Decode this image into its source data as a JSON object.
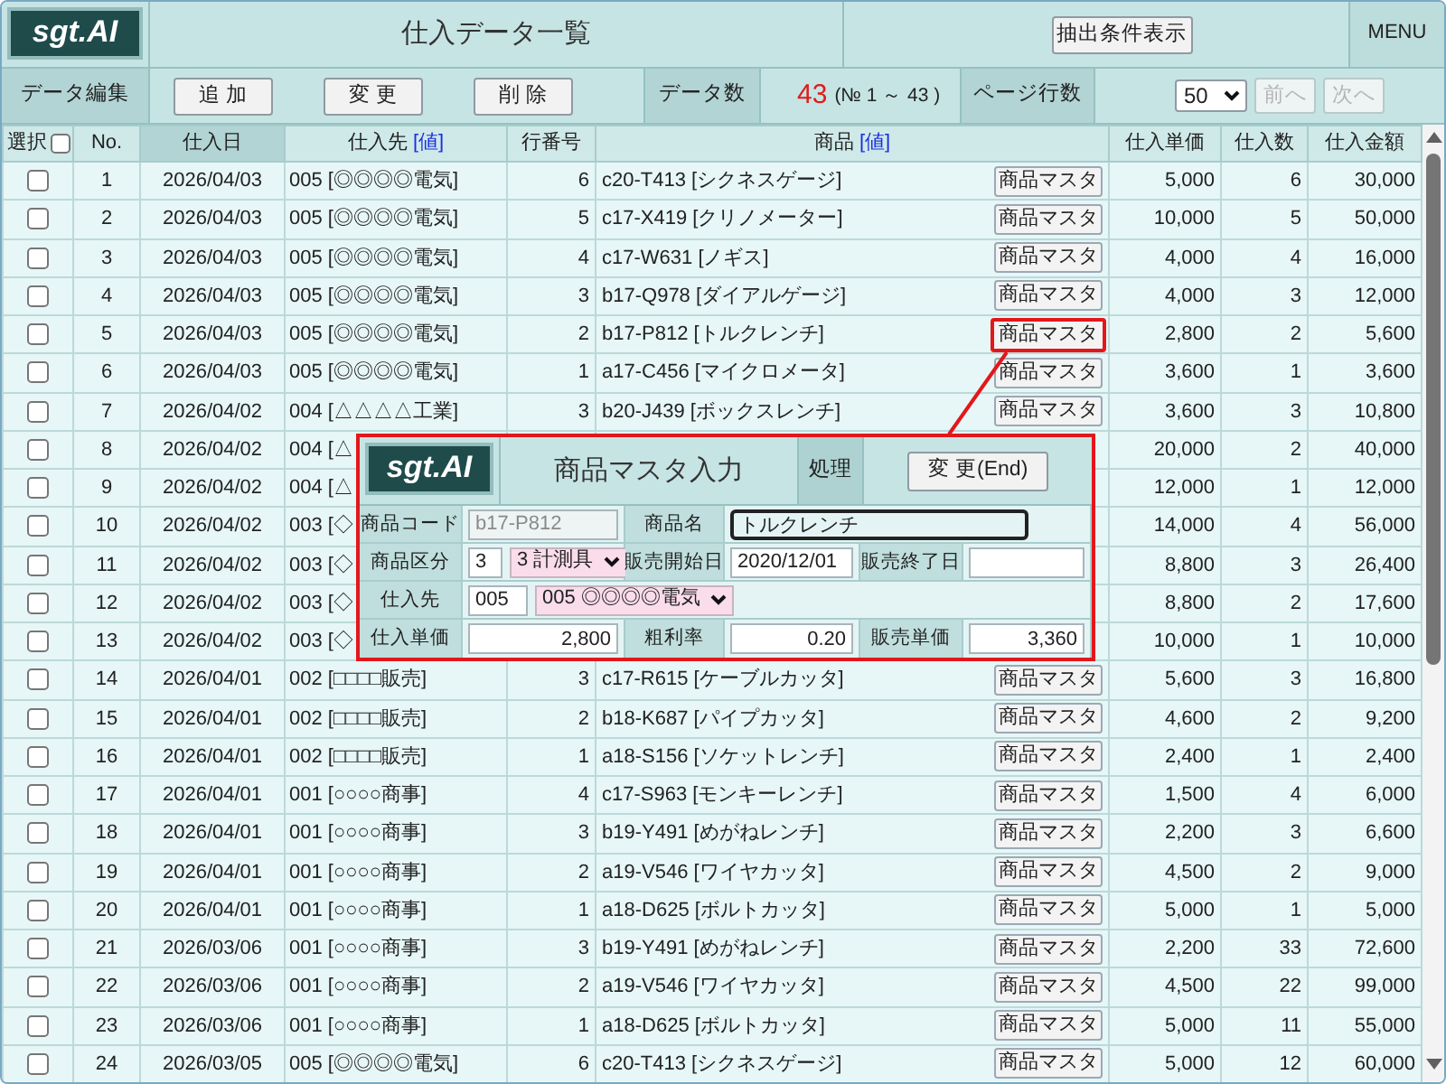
{
  "app": {
    "logo": "sgt.AI",
    "title": "仕入データ一覧",
    "filter_button": "抽出条件表示",
    "menu": "MENU"
  },
  "toolbar": {
    "edit_label": "データ編集",
    "edit_buttons": [
      "追 加",
      "変 更",
      "削 除"
    ],
    "count_label": "データ数",
    "count": "43",
    "range": "(№ 1 ～ 43 )",
    "page_rows_label": "ページ行数",
    "page_rows": "50",
    "nav_buttons": [
      {
        "label": "前へ",
        "disabled": true
      },
      {
        "label": "次へ",
        "disabled": true
      }
    ]
  },
  "table": {
    "columns": [
      {
        "label": "選択",
        "kind": "checkbox",
        "checked": false,
        "sorted": false
      },
      {
        "label": "No.",
        "kind": "text",
        "sorted": false
      },
      {
        "label": "仕入日",
        "kind": "text",
        "sorted": true
      },
      {
        "label": "仕入先",
        "kind": "link",
        "link": "[値]",
        "sorted": false
      },
      {
        "label": "行番号",
        "kind": "text",
        "sorted": false
      },
      {
        "label": "商品",
        "kind": "link",
        "link": "[値]",
        "sorted": false
      },
      {
        "label": "仕入単価",
        "kind": "text",
        "sorted": false
      },
      {
        "label": "仕入数",
        "kind": "text",
        "sorted": false
      },
      {
        "label": "仕入金額",
        "kind": "text",
        "sorted": false
      }
    ],
    "rows": [
      {
        "checked": false,
        "no": "1",
        "date": "2026/04/03",
        "supplier": "005 [◎◎◎◎電気]",
        "line": "6",
        "product": "c20-T413 [シクネスゲージ]",
        "master_button": "商品マスタ",
        "highlighted": false,
        "unit_price": "5,000",
        "qty": "6",
        "amount": "30,000"
      },
      {
        "checked": false,
        "no": "2",
        "date": "2026/04/03",
        "supplier": "005 [◎◎◎◎電気]",
        "line": "5",
        "product": "c17-X419 [クリノメーター]",
        "master_button": "商品マスタ",
        "highlighted": false,
        "unit_price": "10,000",
        "qty": "5",
        "amount": "50,000"
      },
      {
        "checked": false,
        "no": "3",
        "date": "2026/04/03",
        "supplier": "005 [◎◎◎◎電気]",
        "line": "4",
        "product": "c17-W631 [ノギス]",
        "master_button": "商品マスタ",
        "highlighted": false,
        "unit_price": "4,000",
        "qty": "4",
        "amount": "16,000"
      },
      {
        "checked": false,
        "no": "4",
        "date": "2026/04/03",
        "supplier": "005 [◎◎◎◎電気]",
        "line": "3",
        "product": "b17-Q978 [ダイアルゲージ]",
        "master_button": "商品マスタ",
        "highlighted": false,
        "unit_price": "4,000",
        "qty": "3",
        "amount": "12,000"
      },
      {
        "checked": false,
        "no": "5",
        "date": "2026/04/03",
        "supplier": "005 [◎◎◎◎電気]",
        "line": "2",
        "product": "b17-P812 [トルクレンチ]",
        "master_button": "商品マスタ",
        "highlighted": true,
        "unit_price": "2,800",
        "qty": "2",
        "amount": "5,600"
      },
      {
        "checked": false,
        "no": "6",
        "date": "2026/04/03",
        "supplier": "005 [◎◎◎◎電気]",
        "line": "1",
        "product": "a17-C456 [マイクロメータ]",
        "master_button": "商品マスタ",
        "highlighted": false,
        "unit_price": "3,600",
        "qty": "1",
        "amount": "3,600"
      },
      {
        "checked": false,
        "no": "7",
        "date": "2026/04/02",
        "supplier": "004 [△△△△工業]",
        "line": "3",
        "product": "b20-J439 [ボックスレンチ]",
        "master_button": "商品マスタ",
        "highlighted": false,
        "unit_price": "3,600",
        "qty": "3",
        "amount": "10,800"
      },
      {
        "checked": false,
        "no": "8",
        "date": "2026/04/02",
        "supplier": "004 [△",
        "unit_price": "20,000",
        "qty": "2",
        "amount": "40,000"
      },
      {
        "checked": false,
        "no": "9",
        "date": "2026/04/02",
        "supplier": "004 [△",
        "unit_price": "12,000",
        "qty": "1",
        "amount": "12,000"
      },
      {
        "checked": false,
        "no": "10",
        "date": "2026/04/02",
        "supplier": "003 [◇",
        "unit_price": "14,000",
        "qty": "4",
        "amount": "56,000"
      },
      {
        "checked": false,
        "no": "11",
        "date": "2026/04/02",
        "supplier": "003 [◇",
        "unit_price": "8,800",
        "qty": "3",
        "amount": "26,400"
      },
      {
        "checked": false,
        "no": "12",
        "date": "2026/04/02",
        "supplier": "003 [◇",
        "unit_price": "8,800",
        "qty": "2",
        "amount": "17,600"
      },
      {
        "checked": false,
        "no": "13",
        "date": "2026/04/02",
        "supplier": "003 [◇",
        "unit_price": "10,000",
        "qty": "1",
        "amount": "10,000"
      },
      {
        "checked": false,
        "no": "14",
        "date": "2026/04/01",
        "supplier": "002 [□□□□販売]",
        "line": "3",
        "product": "c17-R615 [ケーブルカッタ]",
        "master_button": "商品マスタ",
        "highlighted": false,
        "unit_price": "5,600",
        "qty": "3",
        "amount": "16,800"
      },
      {
        "checked": false,
        "no": "15",
        "date": "2026/04/01",
        "supplier": "002 [□□□□販売]",
        "line": "2",
        "product": "b18-K687 [パイプカッタ]",
        "master_button": "商品マスタ",
        "highlighted": false,
        "unit_price": "4,600",
        "qty": "2",
        "amount": "9,200"
      },
      {
        "checked": false,
        "no": "16",
        "date": "2026/04/01",
        "supplier": "002 [□□□□販売]",
        "line": "1",
        "product": "a18-S156 [ソケットレンチ]",
        "master_button": "商品マスタ",
        "highlighted": false,
        "unit_price": "2,400",
        "qty": "1",
        "amount": "2,400"
      },
      {
        "checked": false,
        "no": "17",
        "date": "2026/04/01",
        "supplier": "001 [○○○○商事]",
        "line": "4",
        "product": "c17-S963 [モンキーレンチ]",
        "master_button": "商品マスタ",
        "highlighted": false,
        "unit_price": "1,500",
        "qty": "4",
        "amount": "6,000"
      },
      {
        "checked": false,
        "no": "18",
        "date": "2026/04/01",
        "supplier": "001 [○○○○商事]",
        "line": "3",
        "product": "b19-Y491 [めがねレンチ]",
        "master_button": "商品マスタ",
        "highlighted": false,
        "unit_price": "2,200",
        "qty": "3",
        "amount": "6,600"
      },
      {
        "checked": false,
        "no": "19",
        "date": "2026/04/01",
        "supplier": "001 [○○○○商事]",
        "line": "2",
        "product": "a19-V546 [ワイヤカッタ]",
        "master_button": "商品マスタ",
        "highlighted": false,
        "unit_price": "4,500",
        "qty": "2",
        "amount": "9,000"
      },
      {
        "checked": false,
        "no": "20",
        "date": "2026/04/01",
        "supplier": "001 [○○○○商事]",
        "line": "1",
        "product": "a18-D625 [ボルトカッタ]",
        "master_button": "商品マスタ",
        "highlighted": false,
        "unit_price": "5,000",
        "qty": "1",
        "amount": "5,000"
      },
      {
        "checked": false,
        "no": "21",
        "date": "2026/03/06",
        "supplier": "001 [○○○○商事]",
        "line": "3",
        "product": "b19-Y491 [めがねレンチ]",
        "master_button": "商品マスタ",
        "highlighted": false,
        "unit_price": "2,200",
        "qty": "33",
        "amount": "72,600"
      },
      {
        "checked": false,
        "no": "22",
        "date": "2026/03/06",
        "supplier": "001 [○○○○商事]",
        "line": "2",
        "product": "a19-V546 [ワイヤカッタ]",
        "master_button": "商品マスタ",
        "highlighted": false,
        "unit_price": "4,500",
        "qty": "22",
        "amount": "99,000"
      },
      {
        "checked": false,
        "no": "23",
        "date": "2026/03/06",
        "supplier": "001 [○○○○商事]",
        "line": "1",
        "product": "a18-D625 [ボルトカッタ]",
        "master_button": "商品マスタ",
        "highlighted": false,
        "unit_price": "5,000",
        "qty": "11",
        "amount": "55,000"
      },
      {
        "checked": false,
        "no": "24",
        "date": "2026/03/05",
        "supplier": "005 [◎◎◎◎電気]",
        "line": "6",
        "product": "c20-T413 [シクネスゲージ]",
        "master_button": "商品マスタ",
        "highlighted": false,
        "unit_price": "5,000",
        "qty": "12",
        "amount": "60,000"
      }
    ]
  },
  "popup": {
    "logo": "sgt.AI",
    "title": "商品マスタ入力",
    "action_label": "処理",
    "action_button": "変 更(End)",
    "rows": [
      [
        {
          "kind": "label",
          "text": "商品コード"
        },
        {
          "kind": "fields",
          "controls": [
            {
              "kind": "text",
              "value": "b17-P812",
              "disabled": true,
              "focused": false
            }
          ]
        },
        {
          "kind": "label",
          "text": "商品名"
        },
        {
          "kind": "fields",
          "controls": [
            {
              "kind": "text",
              "value": "トルクレンチ",
              "disabled": false,
              "focused": true
            }
          ]
        }
      ],
      [
        {
          "kind": "label",
          "text": "商品区分"
        },
        {
          "kind": "fields",
          "controls": [
            {
              "kind": "text",
              "value": "3",
              "disabled": false,
              "focused": false
            },
            {
              "kind": "select",
              "value": "3 計測具"
            }
          ]
        },
        {
          "kind": "label",
          "text": "販売開始日"
        },
        {
          "kind": "fields",
          "controls": [
            {
              "kind": "text",
              "value": "2020/12/01",
              "disabled": false,
              "focused": false
            }
          ]
        },
        {
          "kind": "label",
          "text": "販売終了日"
        },
        {
          "kind": "fields",
          "controls": [
            {
              "kind": "text",
              "disabled": false,
              "focused": false
            }
          ]
        }
      ],
      [
        {
          "kind": "label",
          "text": "仕入先"
        },
        {
          "kind": "fields",
          "controls": [
            {
              "kind": "text",
              "value": "005",
              "disabled": false,
              "focused": false
            },
            {
              "kind": "select",
              "value": "005 ◎◎◎◎電気"
            }
          ]
        }
      ],
      [
        {
          "kind": "label",
          "text": "仕入単価"
        },
        {
          "kind": "fields",
          "controls": [
            {
              "kind": "number",
              "value": "2,800",
              "disabled": false,
              "focused": false
            }
          ]
        },
        {
          "kind": "label",
          "text": "粗利率"
        },
        {
          "kind": "fields",
          "controls": [
            {
              "kind": "number",
              "value": "0.20",
              "disabled": false,
              "focused": false
            }
          ]
        },
        {
          "kind": "label",
          "text": "販売単価"
        },
        {
          "kind": "fields",
          "controls": [
            {
              "kind": "number",
              "value": "3,360",
              "disabled": false,
              "focused": false
            }
          ]
        }
      ]
    ]
  }
}
